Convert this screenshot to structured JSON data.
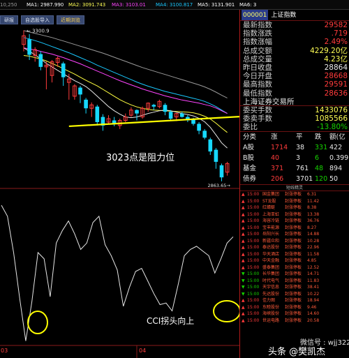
{
  "top_indicators": [
    {
      "text": "10,250",
      "color": "#9a9a9a"
    },
    {
      "text": "MA1: 2987.990",
      "color": "#ffffff"
    },
    {
      "text": "MA2: 3091.743",
      "color": "#ffff55"
    },
    {
      "text": "MA3: 3103.01",
      "color": "#ff44ff"
    },
    {
      "text": "MA4: 3100.817",
      "color": "#19c8ff"
    },
    {
      "text": "MA5: 3131.901",
      "color": "#ffffff"
    },
    {
      "text": "MA6: 3",
      "color": "#ffffff"
    }
  ],
  "nav_tabs": [
    "研报",
    "自选股导入",
    "近期浏览"
  ],
  "kline": {
    "high_label": "3300.9",
    "low_label": "2863.65",
    "annotation": "3023点是阻力位",
    "candles": [
      {
        "o": 3260,
        "c": 3285,
        "h": 3300.9,
        "l": 3240
      },
      {
        "o": 3275,
        "c": 3230,
        "h": 3290,
        "l": 3215
      },
      {
        "o": 3228,
        "c": 3245,
        "h": 3252,
        "l": 3210
      },
      {
        "o": 3232,
        "c": 3195,
        "h": 3240,
        "l": 3185
      },
      {
        "o": 3195,
        "c": 3200,
        "h": 3210,
        "l": 3130
      },
      {
        "o": 3170,
        "c": 3210,
        "h": 3215,
        "l": 3150
      },
      {
        "o": 3208,
        "c": 3220,
        "h": 3225,
        "l": 3195
      },
      {
        "o": 3205,
        "c": 3165,
        "h": 3210,
        "l": 3140
      },
      {
        "o": 3150,
        "c": 3160,
        "h": 3175,
        "l": 3100
      },
      {
        "o": 3110,
        "c": 3140,
        "h": 3145,
        "l": 3100
      },
      {
        "o": 3135,
        "c": 3115,
        "h": 3140,
        "l": 3090
      },
      {
        "o": 3100,
        "c": 3075,
        "h": 3105,
        "l": 3060
      },
      {
        "o": 3075,
        "c": 3085,
        "h": 3092,
        "l": 3050
      },
      {
        "o": 3080,
        "c": 3035,
        "h": 3085,
        "l": 3025
      },
      {
        "o": 3050,
        "c": 3025,
        "h": 3058,
        "l": 3010
      },
      {
        "o": 3035,
        "c": 3045,
        "h": 3055,
        "l": 3028
      },
      {
        "o": 3040,
        "c": 3030,
        "h": 3050,
        "l": 3023
      },
      {
        "o": 3025,
        "c": 3040,
        "h": 3045,
        "l": 3015
      },
      {
        "o": 3040,
        "c": 3050,
        "h": 3060,
        "l": 3035
      },
      {
        "o": 3055,
        "c": 3070,
        "h": 3078,
        "l": 3050
      },
      {
        "o": 3070,
        "c": 3060,
        "h": 3072,
        "l": 3040
      },
      {
        "o": 3050,
        "c": 3075,
        "h": 3080,
        "l": 3045
      },
      {
        "o": 3075,
        "c": 3090,
        "h": 3092,
        "l": 3065
      },
      {
        "o": 3085,
        "c": 3080,
        "h": 3088,
        "l": 3070
      },
      {
        "o": 3080,
        "c": 3095,
        "h": 3100,
        "l": 3075
      },
      {
        "o": 3085,
        "c": 3065,
        "h": 3090,
        "l": 3055
      },
      {
        "o": 3065,
        "c": 3045,
        "h": 3070,
        "l": 3040
      },
      {
        "o": 3050,
        "c": 3060,
        "h": 3062,
        "l": 3038
      },
      {
        "o": 3060,
        "c": 3050,
        "h": 3065,
        "l": 3048
      },
      {
        "o": 3050,
        "c": 3040,
        "h": 3055,
        "l": 3035
      },
      {
        "o": 3042,
        "c": 3030,
        "h": 3048,
        "l": 3025
      },
      {
        "o": 3030,
        "c": 3010,
        "h": 3035,
        "l": 3000
      },
      {
        "o": 3010,
        "c": 2990,
        "h": 3015,
        "l": 2985
      },
      {
        "o": 2985,
        "c": 2950,
        "h": 2990,
        "l": 2940
      },
      {
        "o": 2955,
        "c": 2920,
        "h": 2960,
        "l": 2900
      },
      {
        "o": 2910,
        "c": 2875,
        "h": 2915,
        "l": 2863.65
      },
      {
        "o": 2890,
        "c": 2915,
        "h": 2920,
        "l": 2880
      }
    ],
    "ma_white": [
      3250,
      3240,
      3230,
      3218,
      3205,
      3195,
      3185,
      3175,
      3165,
      3155,
      3147,
      3138,
      3125,
      3110,
      3095,
      3080,
      3068,
      3058,
      3050,
      3048,
      3050,
      3055,
      3060,
      3064,
      3068,
      3070,
      3068,
      3064,
      3060,
      3057,
      3053,
      3046,
      3036,
      3020,
      2998,
      2975,
      2960
    ],
    "ma_yellow": [
      3228,
      3226,
      3222,
      3218,
      3212,
      3205,
      3198,
      3190,
      3182,
      3174,
      3165,
      3156,
      3148,
      3140,
      3130,
      3120,
      3110,
      3100,
      3092,
      3085,
      3079,
      3075,
      3072,
      3070,
      3069,
      3068,
      3067,
      3066,
      3065,
      3064,
      3062,
      3058,
      3052,
      3044,
      3032,
      3018,
      3005
    ],
    "ma_magenta": [
      3250,
      3247,
      3244,
      3240,
      3236,
      3232,
      3227,
      3222,
      3216,
      3210,
      3204,
      3197,
      3190,
      3183,
      3176,
      3169,
      3162,
      3155,
      3149,
      3143,
      3137,
      3131,
      3126,
      3121,
      3116,
      3111,
      3107,
      3103,
      3099,
      3096,
      3093,
      3090,
      3086,
      3082,
      3076,
      3068,
      3060
    ],
    "ma_cyan": [
      3280,
      3276,
      3271,
      3266,
      3260,
      3254,
      3248,
      3242,
      3236,
      3229,
      3222,
      3215,
      3208,
      3200,
      3193,
      3186,
      3179,
      3172,
      3165,
      3158,
      3151,
      3145,
      3139,
      3134,
      3129,
      3124,
      3120,
      3116,
      3112,
      3108,
      3104,
      3100,
      3095,
      3088,
      3080,
      3070,
      3060
    ],
    "ma_gray": [
      3300,
      3296,
      3292,
      3288,
      3284,
      3280,
      3275,
      3270,
      3265,
      3260,
      3255,
      3250,
      3245,
      3240,
      3235,
      3229,
      3223,
      3217,
      3211,
      3205,
      3199,
      3193,
      3188,
      3183,
      3178,
      3173,
      3168,
      3163,
      3158,
      3153,
      3148,
      3143,
      3137,
      3130,
      3122,
      3113,
      3105
    ]
  },
  "cci": {
    "annotation": "CCI拐头向上",
    "values": [
      110,
      75,
      -40,
      -185,
      -320,
      -195,
      -40,
      -60,
      -180,
      -10,
      30,
      60,
      20,
      -30,
      -10,
      55,
      75,
      -15,
      -50,
      -95,
      -210,
      -150,
      -100,
      -90,
      -130,
      -170,
      -205,
      -200,
      -225,
      -140,
      -50,
      -30,
      -20,
      -35,
      -50,
      -105,
      -60,
      -10,
      10
    ]
  },
  "date_labels": [
    "03",
    "04"
  ],
  "right_panel": {
    "code": "000001",
    "name": "上证指数",
    "quote_rows": [
      {
        "label": "最新指数",
        "value": "29582",
        "color": "red"
      },
      {
        "label": "指数涨跌",
        "value": ".719",
        "color": "red"
      },
      {
        "label": "指数涨幅",
        "value": "2.49%",
        "color": "red"
      },
      {
        "label": "总成交额",
        "value": "4229.20亿",
        "color": "yellow"
      },
      {
        "label": "总成交量",
        "value": "4.23亿",
        "color": "yellow"
      },
      {
        "label": "昨日收盘",
        "value": "28864",
        "color": "white"
      },
      {
        "label": "今日开盘",
        "value": "28668",
        "color": "red"
      },
      {
        "label": "最高指数",
        "value": "29591",
        "color": "red"
      },
      {
        "label": "最低指数",
        "value": "28636",
        "color": "red"
      }
    ],
    "exchange": "上海证券交易所",
    "order_rows": [
      {
        "label": "委买手数",
        "value": "1433076",
        "color": "yellow"
      },
      {
        "label": "委卖手数",
        "value": "1085566",
        "color": "yellow"
      },
      {
        "label": "委比",
        "value": "-13.80%",
        "color": "green"
      }
    ],
    "breadth_header": [
      "分类",
      "涨",
      "平",
      "跌",
      "额(亿"
    ],
    "breadth_rows": [
      {
        "cells": [
          "A股",
          "1714",
          "38",
          "331",
          "422"
        ]
      },
      {
        "cells": [
          "B股",
          "40",
          "3",
          "6",
          "0.399"
        ]
      },
      {
        "cells": [
          "基金",
          "371",
          "761",
          "48",
          "894"
        ]
      },
      {
        "cells": [
          "债券",
          "206",
          "3701",
          "120",
          "50"
        ]
      }
    ],
    "list_title": "短线精灵",
    "list": [
      {
        "time": "15:00",
        "name": "国金集团",
        "action": "封涨停板",
        "val": "6.31",
        "up": true
      },
      {
        "time": "15:00",
        "name": "ST龙股",
        "action": "封涨停板",
        "val": "11.42",
        "up": true
      },
      {
        "time": "15:00",
        "name": "红蜻蜓",
        "action": "封涨停板",
        "val": "8.38",
        "up": true
      },
      {
        "time": "15:00",
        "name": "上海亚虹",
        "action": "封涨停板",
        "val": "13.38",
        "up": true
      },
      {
        "time": "15:00",
        "name": "海容冷链",
        "action": "封涨停板",
        "val": "36.76",
        "up": true
      },
      {
        "time": "15:00",
        "name": "宝丰能源",
        "action": "封涨停板",
        "val": "8.27",
        "up": true
      },
      {
        "time": "15:00",
        "name": "岳阳兴长",
        "action": "封涨停板",
        "val": "14.88",
        "up": true
      },
      {
        "time": "15:00",
        "name": "新疆众和",
        "action": "封涨停板",
        "val": "10.28",
        "up": true
      },
      {
        "time": "15:00",
        "name": "泰达股份",
        "action": "封涨停板",
        "val": "22.96",
        "up": true
      },
      {
        "time": "15:00",
        "name": "华天酒店",
        "action": "封涨停板",
        "val": "11.58",
        "up": true
      },
      {
        "time": "15:00",
        "name": "中天金融",
        "action": "封涨停板",
        "val": "4.85",
        "up": true
      },
      {
        "time": "15:00",
        "name": "盛泰集团",
        "action": "封涨停板",
        "val": "12.52",
        "up": true
      },
      {
        "time": "15:00",
        "name": "长华集团",
        "action": "封涨停板",
        "val": "14.71",
        "up": false
      },
      {
        "time": "15:00",
        "name": "时代电气",
        "action": "封涨停板",
        "val": "11.83",
        "up": false
      },
      {
        "time": "15:00",
        "name": "天宇信息",
        "action": "封涨停板",
        "val": "38.41",
        "up": false
      },
      {
        "time": "15:00",
        "name": "先达股份",
        "action": "封涨停板",
        "val": "10.22",
        "up": false
      },
      {
        "time": "15:00",
        "name": "佳力图",
        "action": "封涨停板",
        "val": "18.94",
        "up": true
      },
      {
        "time": "15:00",
        "name": "东睦股份",
        "action": "封涨停板",
        "val": "9.46",
        "up": true
      },
      {
        "time": "15:00",
        "name": "海峡股份",
        "action": "封涨停板",
        "val": "14.60",
        "up": true
      },
      {
        "time": "15:00",
        "name": "世运电路",
        "action": "封涨停板",
        "val": "20.58",
        "up": true
      }
    ]
  },
  "watermark": {
    "line1": "微信号 : wjj322",
    "line2": "头条 @樊凯杰"
  },
  "colors": {
    "up": "#ff3b3b",
    "down": "#16d8ff",
    "ma_white": "#e8e8e8",
    "ma_yellow": "#ffff40",
    "ma_magenta": "#ff44ff",
    "ma_cyan": "#19c8ff",
    "ma_gray": "#9a9a9a",
    "resistance": "#ffff00",
    "circle": "#ffff00"
  }
}
